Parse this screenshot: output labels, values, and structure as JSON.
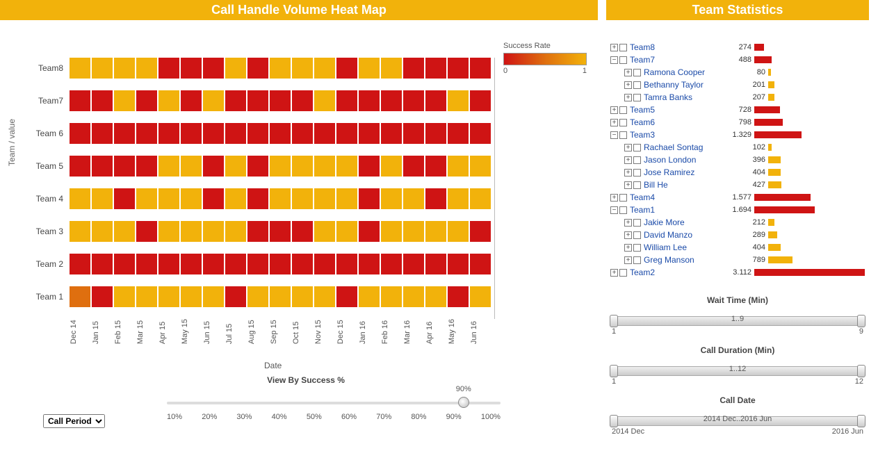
{
  "heatmap": {
    "title": "Call Handle Volume Heat Map",
    "y_axis_title": "Team / value",
    "x_axis_title": "Date",
    "legend_title": "Success Rate",
    "legend_min": "0",
    "legend_max": "1",
    "teams": [
      "Team8",
      "Team7",
      "Team 6",
      "Team 5",
      "Team 4",
      "Team 3",
      "Team 2",
      "Team 1"
    ],
    "dates": [
      "Dec 14",
      "Jan 15",
      "Feb 15",
      "Mar 15",
      "Apr 15",
      "May 15",
      "Jun 15",
      "Jul 15",
      "Aug 15",
      "Sep 15",
      "Oct 15",
      "Nov 15",
      "Dec 15",
      "Jan 16",
      "Feb 16",
      "Mar 16",
      "Apr 16",
      "May 16",
      "Jun 16"
    ]
  },
  "chart_data": {
    "type": "heatmap",
    "title": "Call Handle Volume Heat Map",
    "xlabel": "Date",
    "ylabel": "Team / value",
    "x": [
      "Dec 14",
      "Jan 15",
      "Feb 15",
      "Mar 15",
      "Apr 15",
      "May 15",
      "Jun 15",
      "Jul 15",
      "Aug 15",
      "Sep 15",
      "Oct 15",
      "Nov 15",
      "Dec 15",
      "Jan 16",
      "Feb 16",
      "Mar 16",
      "Apr 16",
      "May 16",
      "Jun 16"
    ],
    "y": [
      "Team8",
      "Team7",
      "Team 6",
      "Team 5",
      "Team 4",
      "Team 3",
      "Team 2",
      "Team 1"
    ],
    "color_scale": {
      "label": "Success Rate",
      "min": 0,
      "max": 1,
      "note": "0≈red, 0.5≈orange, 1≈amber"
    },
    "values": [
      [
        1,
        1,
        1,
        1,
        0,
        0,
        0,
        1,
        0,
        1,
        1,
        1,
        0,
        1,
        1,
        0,
        0,
        0,
        0
      ],
      [
        0,
        0,
        1,
        0,
        1,
        0,
        1,
        0,
        0,
        0,
        0,
        1,
        0,
        0,
        0,
        0,
        0,
        1,
        0
      ],
      [
        0,
        0,
        0,
        0,
        0,
        0,
        0,
        0,
        0,
        0,
        0,
        0,
        0,
        0,
        0,
        0,
        0,
        0,
        0
      ],
      [
        0,
        0,
        0,
        0,
        1,
        1,
        0,
        1,
        0,
        1,
        1,
        1,
        1,
        0,
        1,
        0,
        0,
        1,
        1
      ],
      [
        1,
        1,
        0,
        1,
        1,
        1,
        0,
        1,
        0,
        1,
        1,
        1,
        1,
        0,
        1,
        1,
        0,
        1,
        1
      ],
      [
        1,
        1,
        1,
        0,
        1,
        1,
        1,
        1,
        0,
        0,
        0,
        1,
        1,
        0,
        1,
        1,
        1,
        1,
        0
      ],
      [
        0,
        0,
        0,
        0,
        0,
        0,
        0,
        0,
        0,
        0,
        0,
        0,
        0,
        0,
        0,
        0,
        0,
        0,
        0
      ],
      [
        0.5,
        0,
        1,
        1,
        1,
        1,
        1,
        0,
        1,
        1,
        1,
        1,
        0,
        1,
        1,
        1,
        1,
        0,
        1
      ]
    ]
  },
  "controls": {
    "view_by_title": "View By Success %",
    "success_value_label": "90%",
    "success_value_pct": 88.9,
    "success_ticks": [
      "10%",
      "20%",
      "30%",
      "40%",
      "50%",
      "60%",
      "70%",
      "80%",
      "90%",
      "100%"
    ],
    "period_select_label": "Call Period"
  },
  "teamstats": {
    "title": "Team Statistics",
    "max": 3112,
    "rows": [
      {
        "name": "Team8",
        "value": "274",
        "num": 274,
        "color": "red",
        "state": "plus",
        "indent": 0
      },
      {
        "name": "Team7",
        "value": "488",
        "num": 488,
        "color": "red",
        "state": "minus",
        "indent": 0
      },
      {
        "name": "Ramona Cooper",
        "value": "80",
        "num": 80,
        "color": "amber",
        "state": "plus",
        "indent": 1
      },
      {
        "name": "Bethanny Taylor",
        "value": "201",
        "num": 201,
        "color": "amber",
        "state": "plus",
        "indent": 1
      },
      {
        "name": "Tamra Banks",
        "value": "207",
        "num": 207,
        "color": "amber",
        "state": "plus",
        "indent": 1
      },
      {
        "name": "Team5",
        "value": "728",
        "num": 728,
        "color": "red",
        "state": "plus",
        "indent": 0
      },
      {
        "name": "Team6",
        "value": "798",
        "num": 798,
        "color": "red",
        "state": "plus",
        "indent": 0
      },
      {
        "name": "Team3",
        "value": "1.329",
        "num": 1329,
        "color": "red",
        "state": "minus",
        "indent": 0
      },
      {
        "name": "Rachael Sontag",
        "value": "102",
        "num": 102,
        "color": "amber",
        "state": "plus",
        "indent": 1
      },
      {
        "name": "Jason London",
        "value": "396",
        "num": 396,
        "color": "amber",
        "state": "plus",
        "indent": 1
      },
      {
        "name": "Jose Ramirez",
        "value": "404",
        "num": 404,
        "color": "amber",
        "state": "plus",
        "indent": 1
      },
      {
        "name": "Bill He",
        "value": "427",
        "num": 427,
        "color": "amber",
        "state": "plus",
        "indent": 1
      },
      {
        "name": "Team4",
        "value": "1.577",
        "num": 1577,
        "color": "red",
        "state": "plus",
        "indent": 0
      },
      {
        "name": "Team1",
        "value": "1.694",
        "num": 1694,
        "color": "red",
        "state": "minus",
        "indent": 0
      },
      {
        "name": "Jakie More",
        "value": "212",
        "num": 212,
        "color": "amber",
        "state": "plus",
        "indent": 1
      },
      {
        "name": "David Manzo",
        "value": "289",
        "num": 289,
        "color": "amber",
        "state": "plus",
        "indent": 1
      },
      {
        "name": "William Lee",
        "value": "404",
        "num": 404,
        "color": "amber",
        "state": "plus",
        "indent": 1
      },
      {
        "name": "Greg Manson",
        "value": "789",
        "num": 789,
        "color": "amber",
        "state": "plus",
        "indent": 1
      },
      {
        "name": "Team2",
        "value": "3.112",
        "num": 3112,
        "color": "red",
        "state": "plus",
        "indent": 0
      }
    ]
  },
  "right_sliders": {
    "wait": {
      "title": "Wait Time (Min)",
      "range": "1..9",
      "min": "1",
      "max": "9"
    },
    "duration": {
      "title": "Call Duration (Min)",
      "range": "1..12",
      "min": "1",
      "max": "12"
    },
    "date": {
      "title": "Call Date",
      "range": "2014 Dec..2016 Jun",
      "min": "2014 Dec",
      "max": "2016 Jun"
    }
  }
}
